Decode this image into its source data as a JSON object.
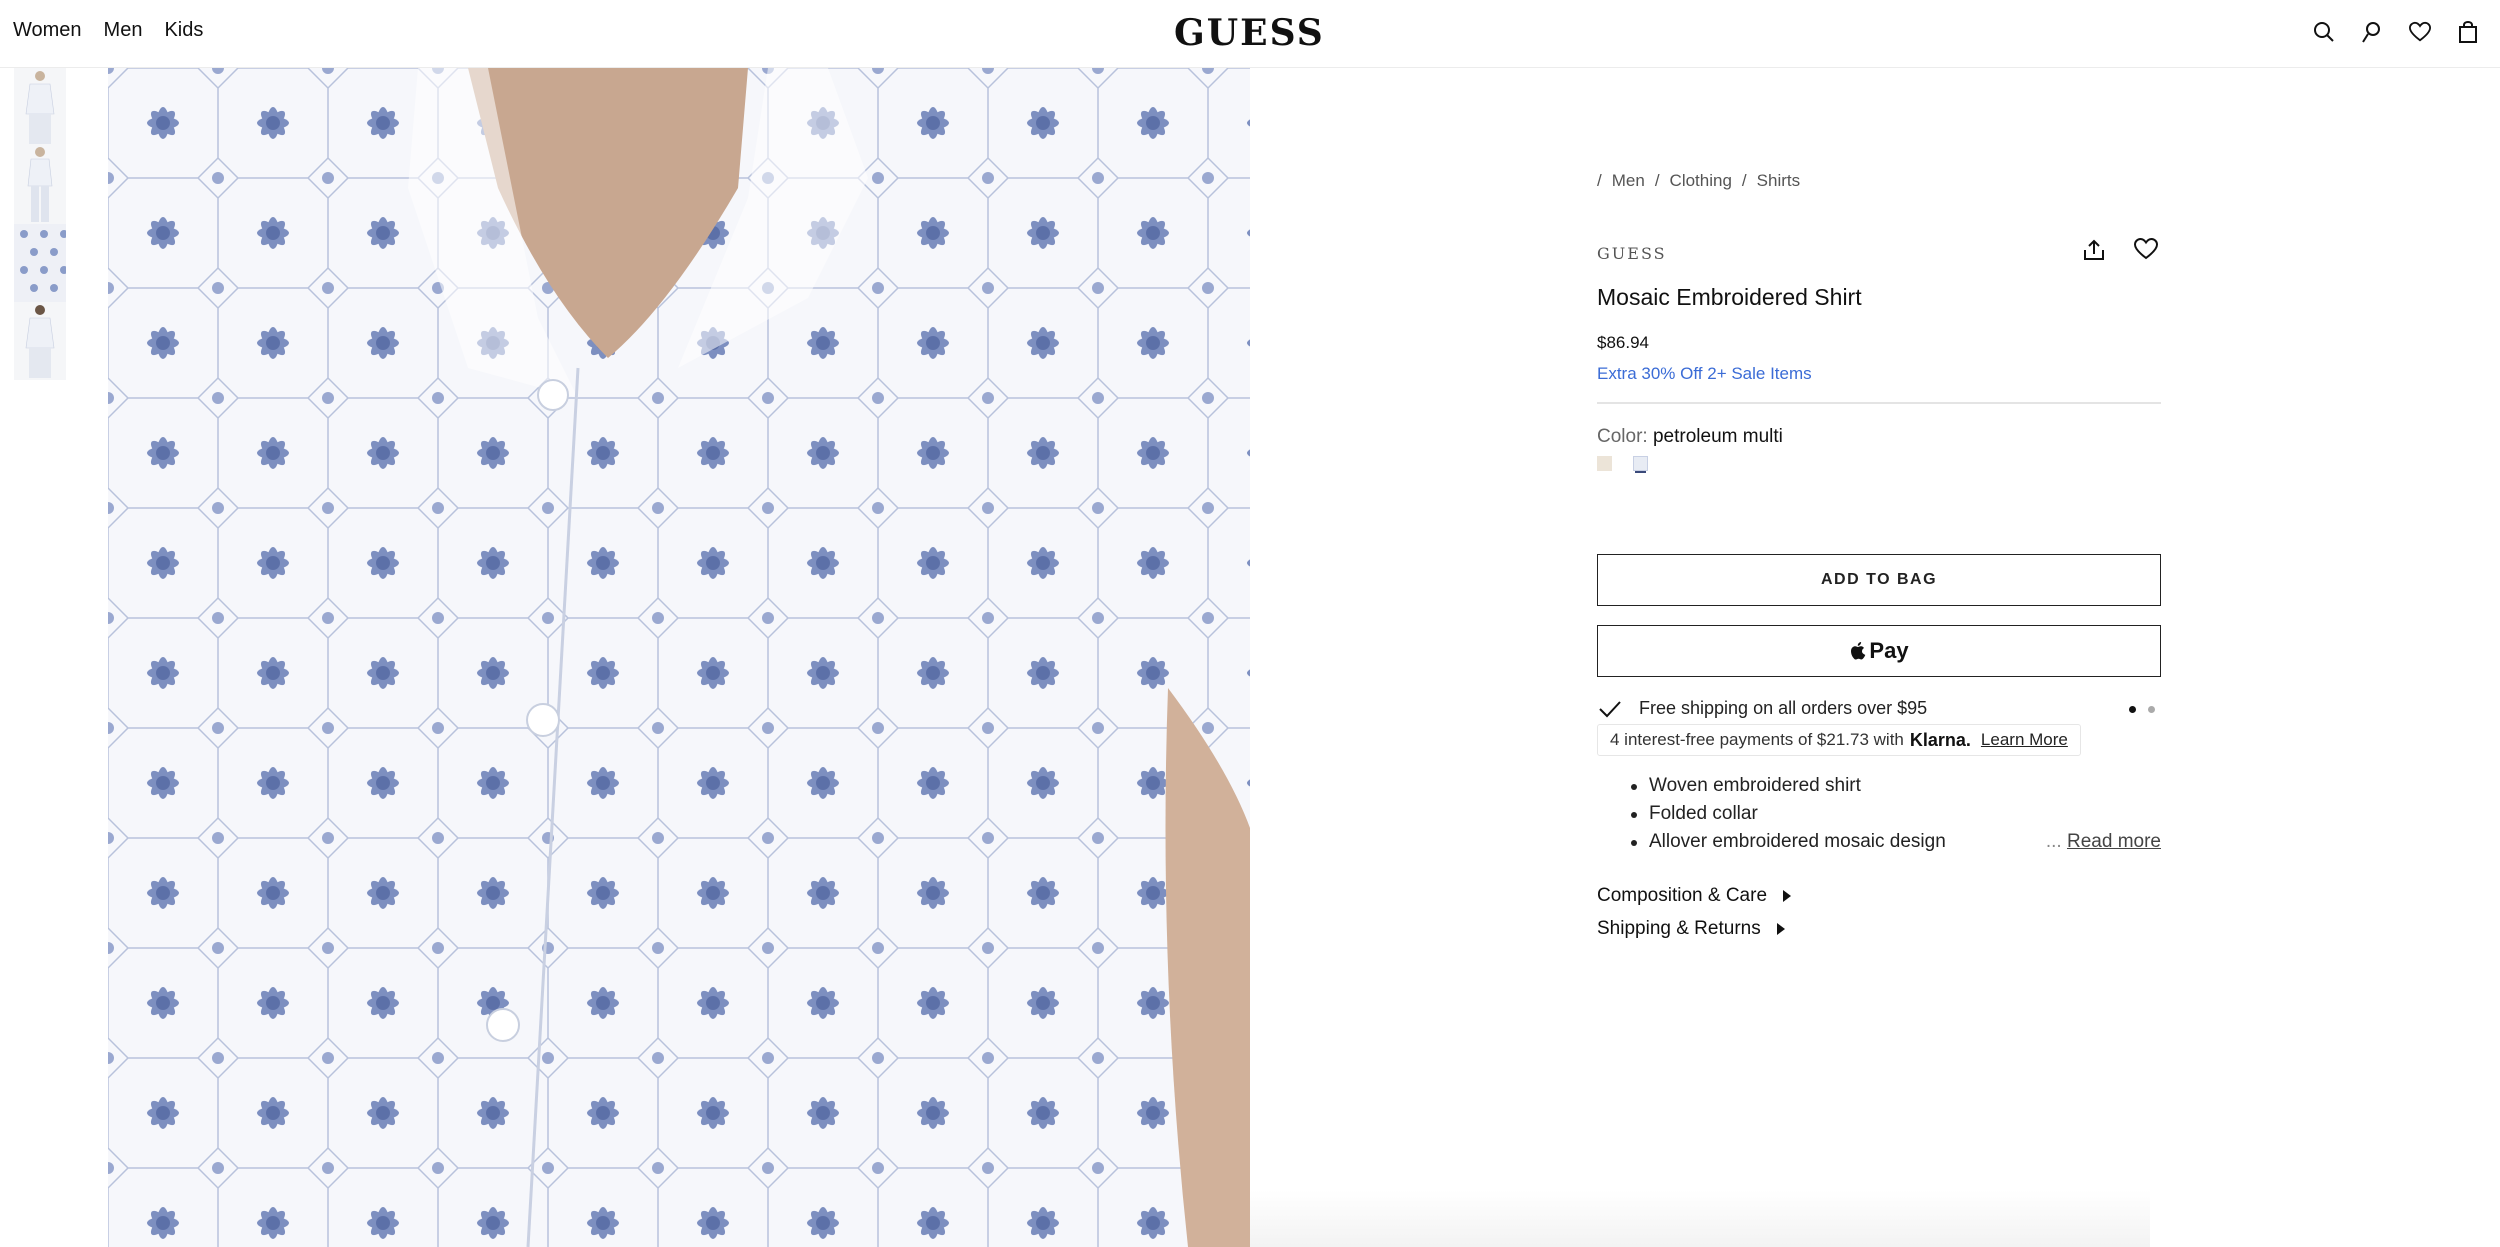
{
  "header": {
    "nav": [
      "Women",
      "Men",
      "Kids"
    ],
    "logo": "GUESS",
    "icons": [
      "search-icon",
      "account-icon",
      "wishlist-icon",
      "bag-icon"
    ]
  },
  "gallery": {
    "thumbnails": [
      "front-full-view",
      "front-full-view-alt",
      "fabric-detail",
      "back-view"
    ],
    "main_image": "shirt-fabric-closeup"
  },
  "product": {
    "breadcrumb": [
      "Men",
      "Clothing",
      "Shirts"
    ],
    "brand": "GUESS",
    "title": "Mosaic Embroidered Shirt",
    "price": "$86.94",
    "promo": "Extra 30% Off 2+ Sale Items",
    "color_label": "Color:",
    "color_value": "petroleum multi",
    "swatches": [
      {
        "name": "cream",
        "color": "#ece4d8"
      },
      {
        "name": "petroleum multi",
        "color": "#e8ecf4"
      }
    ],
    "add_to_bag": "ADD TO BAG",
    "apple_pay": "Pay",
    "shipping": "Free shipping on all orders over $95",
    "klarna_text": "4 interest-free payments of $21.73 with",
    "klarna_logo": "Klarna.",
    "klarna_link": "Learn More",
    "features": [
      "Woven embroidered shirt",
      "Folded collar",
      "Allover embroidered mosaic design"
    ],
    "read_more_ellipsis": "...",
    "read_more": "Read more",
    "accordions": [
      "Composition & Care",
      "Shipping & Returns"
    ],
    "accent_color": "#3b6cd6"
  }
}
